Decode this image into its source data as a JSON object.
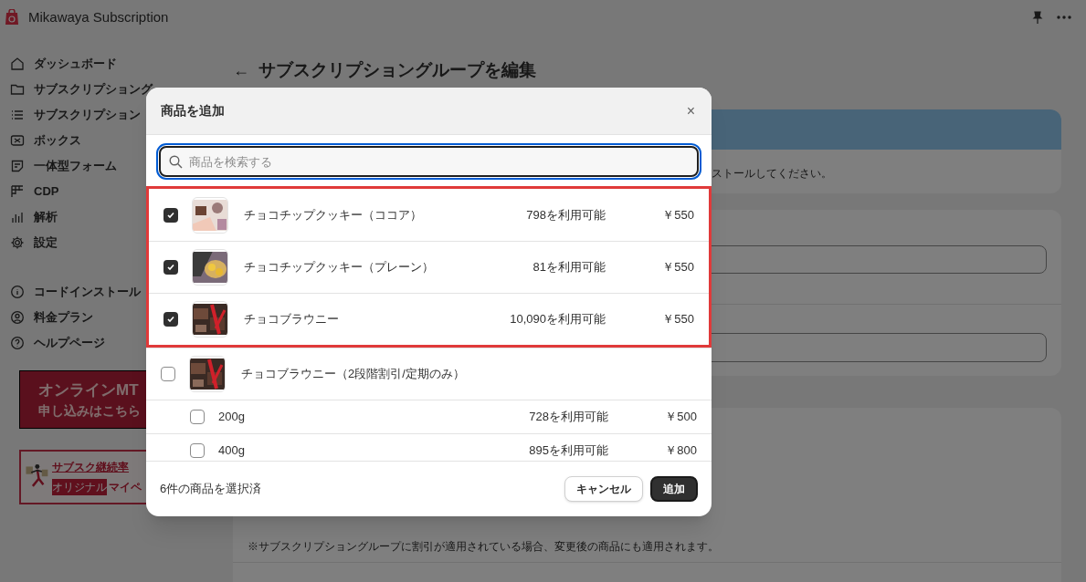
{
  "app": {
    "title": "Mikawaya Subscription"
  },
  "sidebar": {
    "items": [
      {
        "label": "ダッシュボード"
      },
      {
        "label": "サブスクリプショング"
      },
      {
        "label": "サブスクリプション"
      },
      {
        "label": "ボックス"
      },
      {
        "label": "一体型フォーム"
      },
      {
        "label": "CDP"
      },
      {
        "label": "解析"
      },
      {
        "label": "設定"
      }
    ],
    "secondary_items": [
      {
        "label": "コードインストール"
      },
      {
        "label": "料金プラン"
      },
      {
        "label": "ヘルプページ"
      }
    ]
  },
  "banners": {
    "meeting": {
      "lines": [
        "オンラインMT",
        "申し込みはこちら"
      ]
    },
    "promo": {
      "link": "サブスク継続率",
      "badge": "オリジナル",
      "text": "マイペ"
    }
  },
  "page": {
    "back": "←",
    "title": "サブスクリプショングループを編集",
    "notice_text": "ストールしてください。",
    "note": "※サブスクリプショングループに割引が適用されている場合、変更後の商品にも適用されます。"
  },
  "modal": {
    "title": "商品を追加",
    "close": "×",
    "search": {
      "placeholder": "商品を検索する"
    },
    "products": [
      {
        "name": "チョコチップクッキー（ココア）",
        "available": "798を利用可能",
        "price": "￥550",
        "checked": true,
        "highlighted": true
      },
      {
        "name": "チョコチップクッキー（プレーン）",
        "available": "81を利用可能",
        "price": "￥550",
        "checked": true,
        "highlighted": true
      },
      {
        "name": "チョコブラウニー",
        "available": "10,090を利用可能",
        "price": "￥550",
        "checked": true,
        "highlighted": true
      },
      {
        "name": "チョコブラウニー（2段階割引/定期のみ）",
        "checked": false,
        "highlighted": false,
        "variants": [
          {
            "name": "200g",
            "available": "728を利用可能",
            "price": "￥500",
            "checked": false
          },
          {
            "name": "400g",
            "available": "895を利用可能",
            "price": "￥800",
            "checked": false
          }
        ]
      }
    ],
    "selected_count": "6件の商品を選択済",
    "cancel": "キャンセル",
    "add": "追加"
  }
}
